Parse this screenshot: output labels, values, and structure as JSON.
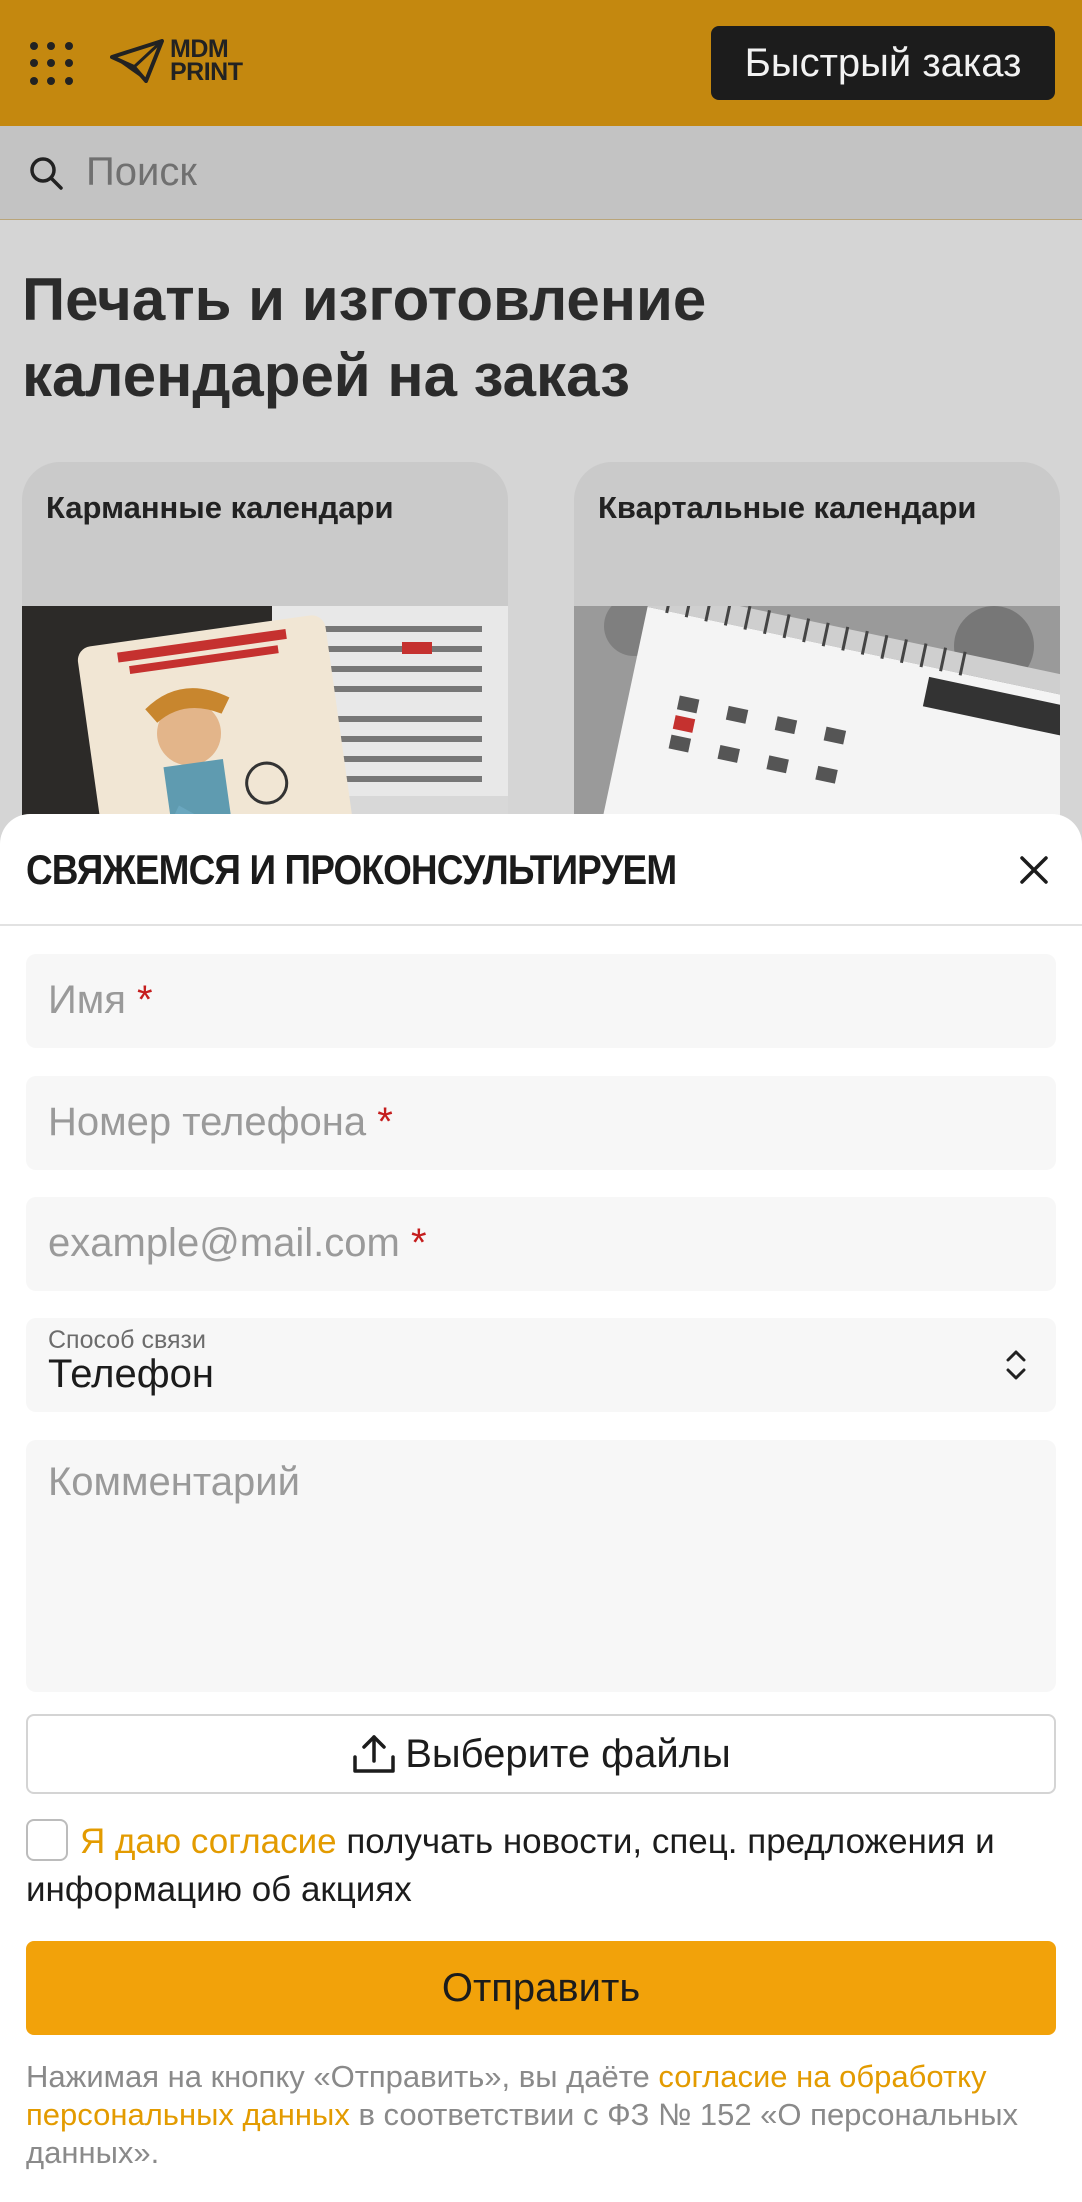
{
  "header": {
    "logo_line1": "MDM",
    "logo_line2": "PRINT",
    "quick_order_label": "Быстрый заказ",
    "accent_color": "#c4880f"
  },
  "search": {
    "placeholder": "Поиск"
  },
  "page": {
    "title": "Печать и изготовление календарей на заказ",
    "cards": [
      {
        "title": "Карманные календари"
      },
      {
        "title": "Квартальные календари"
      }
    ]
  },
  "modal": {
    "title": "СВЯЖЕМСЯ И ПРОКОНСУЛЬТИРУЕМ",
    "fields": {
      "name_placeholder": "Имя",
      "phone_placeholder": "Номер телефона",
      "email_placeholder": "example@mail.com",
      "required_mark": "*",
      "method_label": "Способ связи",
      "method_value": "Телефон",
      "comment_placeholder": "Комментарий"
    },
    "file_button_label": "Выберите файлы",
    "consent": {
      "link_text": "Я даю согласие",
      "rest_text": " получать новости, спец. предложения и информацию об акциях"
    },
    "submit_label": "Отправить",
    "legal": {
      "part1": "Нажимая на кнопку «Отправить», вы даёте ",
      "link": "согласие на обработку персональных данных",
      "part2": " в соответствии с ФЗ № 152 «О персональных данных»."
    },
    "button_color": "#f2a20a"
  }
}
